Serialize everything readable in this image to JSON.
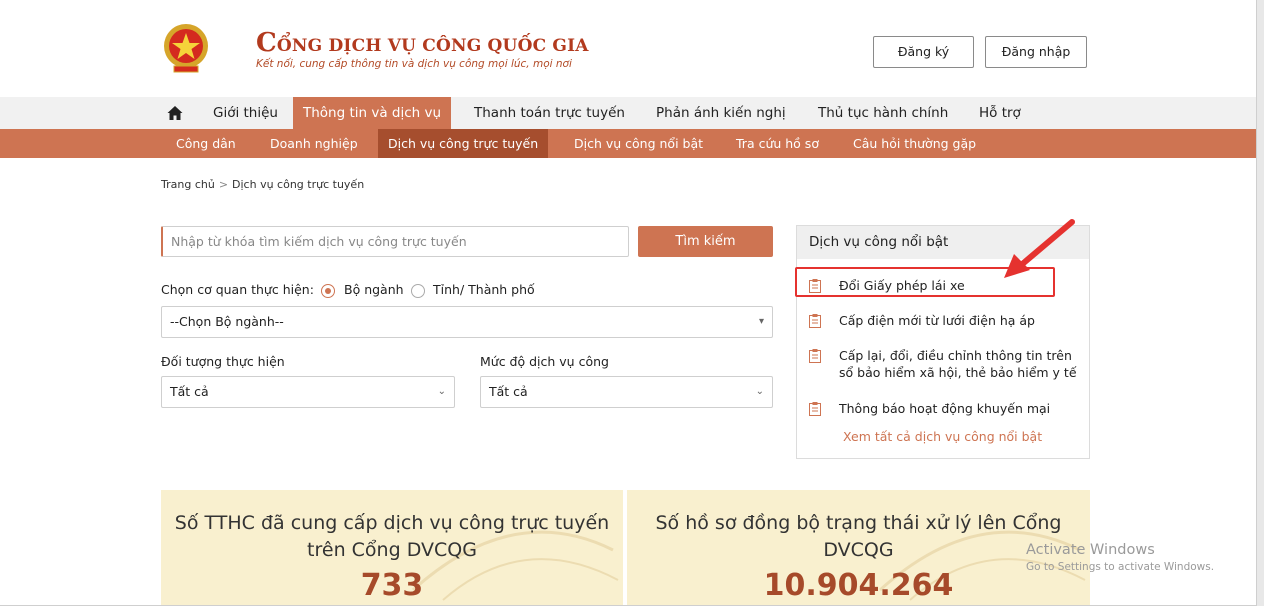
{
  "header": {
    "brand_title_first": "C",
    "brand_title_rest": "ỔNG DỊCH VỤ CÔNG QUỐC GIA",
    "brand_subtitle": "Kết nối, cung cấp thông tin và dịch vụ công mọi lúc, mọi nơi",
    "register_label": "Đăng ký",
    "login_label": "Đăng nhập"
  },
  "main_nav": {
    "items": [
      {
        "label": "Giới thiệu"
      },
      {
        "label": "Thông tin và dịch vụ",
        "active": true
      },
      {
        "label": "Thanh toán trực tuyến"
      },
      {
        "label": "Phản ánh kiến nghị"
      },
      {
        "label": "Thủ tục hành chính"
      },
      {
        "label": "Hỗ trợ"
      }
    ]
  },
  "sub_nav": {
    "items": [
      {
        "label": "Công dân"
      },
      {
        "label": "Doanh nghiệp"
      },
      {
        "label": "Dịch vụ công trực tuyến",
        "active": true
      },
      {
        "label": "Dịch vụ công nổi bật"
      },
      {
        "label": "Tra cứu hồ sơ"
      },
      {
        "label": "Câu hỏi thường gặp"
      }
    ]
  },
  "breadcrumb": {
    "home": "Trang chủ",
    "separator": ">",
    "current": "Dịch vụ công trực tuyến"
  },
  "search": {
    "placeholder": "Nhập từ khóa tìm kiếm dịch vụ công trực tuyến",
    "button_label": "Tìm kiếm"
  },
  "filters": {
    "agency_label": "Chọn cơ quan thực hiện:",
    "agency_options": [
      {
        "label": "Bộ ngành",
        "checked": true
      },
      {
        "label": "Tỉnh/ Thành phố",
        "checked": false
      }
    ],
    "ministry_select_value": "--Chọn Bộ ngành--",
    "subject_label": "Đối tượng thực hiện",
    "subject_value": "Tất cả",
    "level_label": "Mức độ dịch vụ công",
    "level_value": "Tất cả"
  },
  "featured": {
    "heading": "Dịch vụ công nổi bật",
    "items": [
      {
        "label": "Đổi Giấy phép lái xe"
      },
      {
        "label": "Cấp điện mới từ lưới điện hạ áp"
      },
      {
        "label": "Cấp lại, đổi, điều chỉnh thông tin trên sổ bảo hiểm xã hội, thẻ bảo hiểm y tế"
      },
      {
        "label": "Thông báo hoạt động khuyến mại"
      }
    ],
    "view_all": "Xem tất cả dịch vụ công nổi bật"
  },
  "stats": [
    {
      "title": "Số TTHC đã cung cấp dịch vụ công trực tuyến trên Cổng DVCQG",
      "value": "733"
    },
    {
      "title": "Số hồ sơ đồng bộ trạng thái xử lý lên Cổng DVCQG",
      "value": "10.904.264"
    }
  ],
  "watermark": {
    "line1": "Activate Windows",
    "line2": "Go to Settings to activate Windows."
  },
  "colors": {
    "accent": "#ce7452",
    "accent_dark": "#a64e2e",
    "brand_red": "#b23a1e",
    "highlight_red": "#e5322f",
    "stat_bg": "#f9f0cf"
  },
  "icons": [
    "national-emblem-icon",
    "home-icon",
    "document-icon",
    "chevron-down-icon",
    "red-arrow-icon"
  ]
}
